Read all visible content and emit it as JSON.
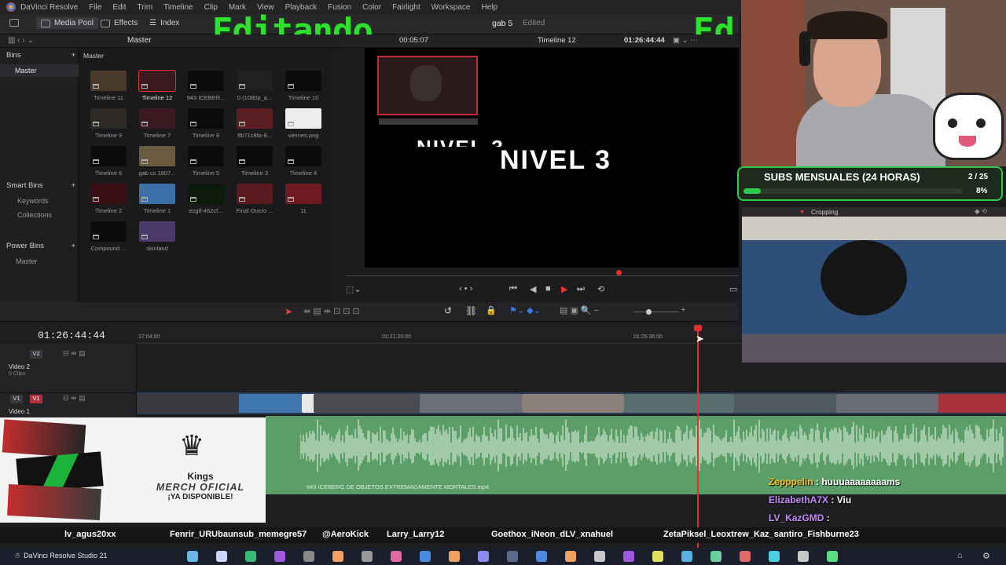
{
  "menubar": {
    "app_name": "DaVinci Resolve",
    "items": [
      "File",
      "Edit",
      "Trim",
      "Timeline",
      "Clip",
      "Mark",
      "View",
      "Playback",
      "Fusion",
      "Color",
      "Fairlight",
      "Workspace",
      "Help"
    ]
  },
  "toolbar": {
    "media_pool": "Media Pool",
    "effects": "Effects",
    "index": "Index",
    "project_name": "gab 5",
    "project_status": "Edited",
    "overlay_title": "Editando. . .",
    "overlay_title_2": "Ed"
  },
  "viewer": {
    "timeline_name": "Timeline 12",
    "timecode": "01:26:44:44",
    "source_timecode": "00:05:07",
    "overlay_text_back": "NIVEL 3",
    "overlay_text_front": "NIVEL 3"
  },
  "subbar": {
    "bin_path": "Master"
  },
  "left_panel": {
    "bins_title": "Bins",
    "master": "Master",
    "smart_bins_title": "Smart Bins",
    "keywords": "Keywords",
    "collections": "Collections",
    "power_bins_title": "Power Bins",
    "power_master": "Master"
  },
  "media_pool": {
    "header": "Master",
    "clips": [
      {
        "label": "Timeline 11"
      },
      {
        "label": "Timeline 12"
      },
      {
        "label": "943 ICEBER..."
      },
      {
        "label": "0 (1080p_a..."
      },
      {
        "label": "Timeline 10"
      },
      {
        "label": "Timeline 9"
      },
      {
        "label": "Timeline 7"
      },
      {
        "label": "Timeline 8"
      },
      {
        "label": "8b71c8fa-8..."
      },
      {
        "label": "viernes.png"
      },
      {
        "label": "Timeline 6"
      },
      {
        "label": "gab cs 1807..."
      },
      {
        "label": "Timeline 5"
      },
      {
        "label": "Timeline 3"
      },
      {
        "label": "Timeline 4"
      },
      {
        "label": "Timeline 2"
      },
      {
        "label": "Timeline 1"
      },
      {
        "label": "ezgif-462cf..."
      },
      {
        "label": "Final Oucro ..."
      },
      {
        "label": "11"
      },
      {
        "label": "Compound ..."
      },
      {
        "label": "skinland"
      }
    ]
  },
  "timeline": {
    "timecode": "01:26:44:44",
    "ruler": [
      "17:04:00",
      "01:21:20:00",
      "01:25:36:00"
    ],
    "tracks": [
      {
        "badge": "V2",
        "name": "Video 2",
        "info": "0 Clips"
      },
      {
        "badge": "V1",
        "name": "Video 1",
        "info": ""
      }
    ],
    "audio_clip_label": "943 ICEBERG DE OBJETOS EXTREMADAMENTE MORTALES.mp4"
  },
  "merch": {
    "brand": "Kings",
    "line1": "MERCH OFICIAL",
    "line2": "¡YA DISPONIBLE!"
  },
  "subs_goal": {
    "label": "SUBS MENSUALES (24 HORAS)",
    "count": "2 / 25",
    "percent_text": "8%",
    "progress": 0.08
  },
  "cropping": {
    "label": "Cropping"
  },
  "chat": [
    {
      "user": "Zepppelin",
      "message": "huuuaaaaaaaams",
      "color": "#f2c02b"
    },
    {
      "user": "ElizabethA7X",
      "message": "Viu",
      "color": "#c58bff"
    },
    {
      "user": "LV_KazGMD",
      "message": "",
      "color": "#c58bff"
    }
  ],
  "ticker": [
    "lv_agus20xx",
    "Fenrir_URUbaunsub_memegre57",
    "@AeroKick",
    "Larry_Larry12",
    "Goethox_iNeon_dLV_xnahuel",
    "ZetaPiksel_Leoxtrew_Kaz_santiro_Fishburne23"
  ],
  "taskbar": {
    "app_label": "DaVinci Resolve Studio 21"
  },
  "colors": {
    "accent_green": "#2fe02f",
    "playhead": "#e03030",
    "audio_clip": "#5b9e68",
    "video_track": "#2a3d55"
  }
}
